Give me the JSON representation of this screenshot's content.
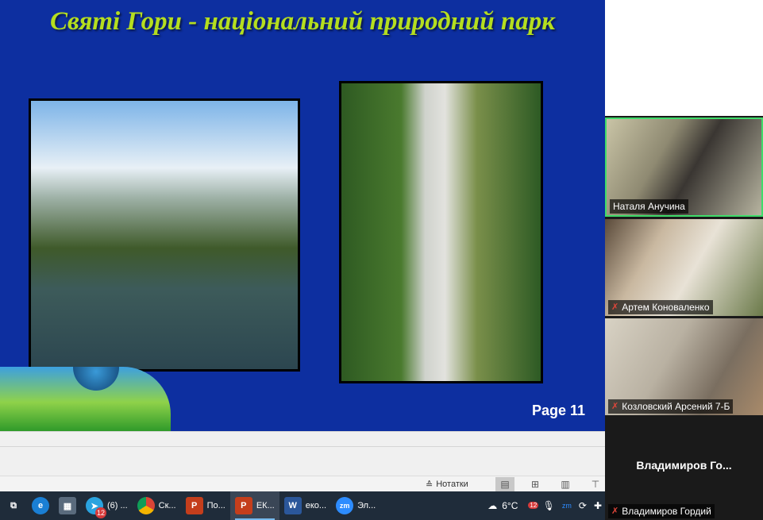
{
  "slide": {
    "title": "Святі Гори - національний природний парк",
    "page": "Page 11"
  },
  "status_bar": {
    "notes_label": "Нотатки"
  },
  "taskbar": {
    "items": [
      {
        "label": "",
        "icon": "task-view-icon"
      },
      {
        "label": "",
        "icon": "edge-icon"
      },
      {
        "label": "",
        "icon": "calculator-icon"
      },
      {
        "label": "(6) ...",
        "icon": "telegram-icon",
        "badge": "12"
      },
      {
        "label": "Ск...",
        "icon": "chrome-icon"
      },
      {
        "label": "По...",
        "icon": "powerpoint-icon"
      },
      {
        "label": "ЕК...",
        "icon": "powerpoint-icon"
      },
      {
        "label": "еко...",
        "icon": "word-icon"
      },
      {
        "label": "Эл...",
        "icon": "zoom-icon"
      }
    ],
    "weather": "6°C",
    "tray_badge": "12"
  },
  "participants": [
    {
      "name": "Наталя Анучина",
      "muted": false
    },
    {
      "name": "Артем Коноваленко",
      "muted": true
    },
    {
      "name": "Козловский Арсений 7-Б",
      "muted": true
    },
    {
      "name": "Владимиров Гордий",
      "display": "Владимиров  Го...",
      "muted": true
    }
  ],
  "colors": {
    "slide_background": "#0d2fa0",
    "title": "#b5de1f",
    "active_speaker_border": "#3fdc6a",
    "taskbar": "#1f2c3a"
  }
}
